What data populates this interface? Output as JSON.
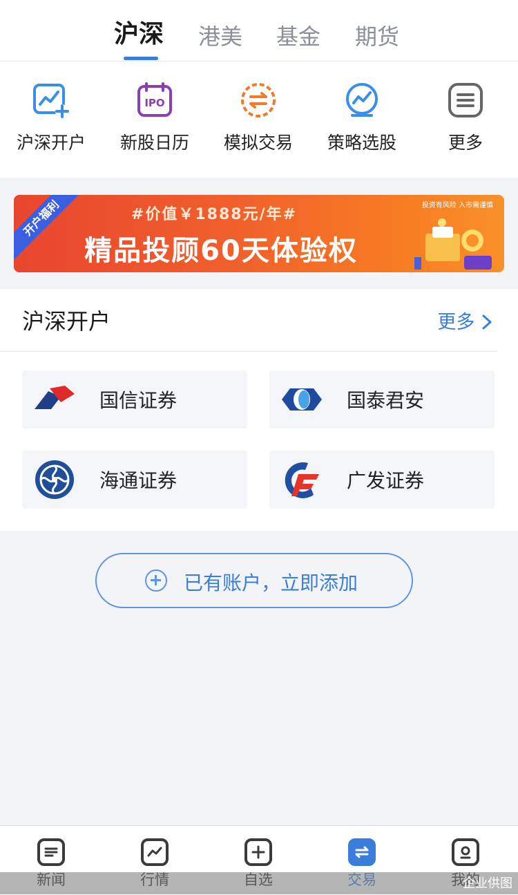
{
  "top_tabs": [
    "沪深",
    "港美",
    "基金",
    "期货"
  ],
  "active_tab": "沪深",
  "quick_actions": [
    {
      "label": "沪深开户",
      "icon": "chart-add-icon"
    },
    {
      "label": "新股日历",
      "icon": "ipo-calendar-icon"
    },
    {
      "label": "模拟交易",
      "icon": "exchange-icon"
    },
    {
      "label": "策略选股",
      "icon": "strategy-icon"
    },
    {
      "label": "更多",
      "icon": "menu-icon"
    }
  ],
  "banner": {
    "ribbon": "开户福利",
    "subtitle": "#价值￥1888元/年#",
    "title": "精品投顾60天体验权",
    "note": "投资有风险 入市需谨慎"
  },
  "section": {
    "title": "沪深开户",
    "more_label": "更多"
  },
  "brokers": [
    {
      "name": "国信证券",
      "logo": "guosen-logo-icon"
    },
    {
      "name": "国泰君安",
      "logo": "gtja-logo-icon"
    },
    {
      "name": "海通证券",
      "logo": "haitong-logo-icon"
    },
    {
      "name": "广发证券",
      "logo": "gf-logo-icon"
    }
  ],
  "add_account_label": "已有账户，立即添加",
  "bottom_nav": [
    {
      "label": "新闻",
      "icon": "news-icon"
    },
    {
      "label": "行情",
      "icon": "market-icon"
    },
    {
      "label": "自选",
      "icon": "watchlist-icon"
    },
    {
      "label": "交易",
      "icon": "trade-icon"
    },
    {
      "label": "我的",
      "icon": "profile-icon"
    }
  ],
  "active_nav": "交易",
  "watermark": "企业供图",
  "colors": {
    "accent": "#3b7ddb",
    "banner_start": "#e8452e",
    "banner_end": "#f9902a"
  }
}
